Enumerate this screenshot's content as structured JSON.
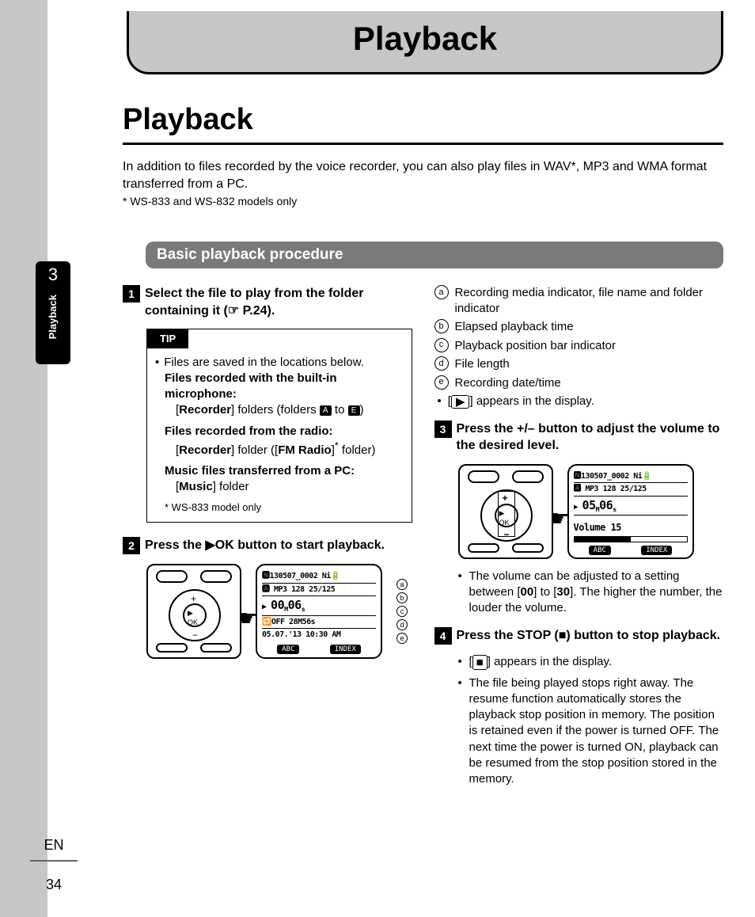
{
  "topTab": "Playback",
  "sectionTitle": "Playback",
  "intro": {
    "p1": "In addition to files recorded by the voice recorder, you can also play files in WAV*, MP3 and WMA format transferred from a PC.",
    "note": "* WS-833 and WS-832 models only"
  },
  "subhead": "Basic playback procedure",
  "sideTab": {
    "num": "3",
    "label": "Playback"
  },
  "footer": {
    "lang": "EN",
    "page": "34"
  },
  "steps": {
    "s1": {
      "num": "1",
      "textA": "Select the file to play from the folder containing it (",
      "pref": "☞ P.24",
      "textB": ")."
    },
    "tip": {
      "label": "TIP",
      "intro": "Files are saved in the locations below.",
      "h1": "Files recorded with the built-in microphone:",
      "d1a": "[",
      "d1b": "Recorder",
      "d1c": "] folders (folders ",
      "fA": "A",
      "d1d": " to ",
      "fE": "E",
      "d1e": ")",
      "h2": "Files recorded from the radio:",
      "d2a": "[",
      "d2b": "Recorder",
      "d2c": "] folder ([",
      "d2d": "FM Radio",
      "d2e": "]",
      "d2star": "*",
      "d2f": " folder)",
      "h3": "Music files transferred from a PC:",
      "d3a": "[",
      "d3b": "Music",
      "d3c": "] folder",
      "note": "* WS-833 model only"
    },
    "s2": {
      "num": "2",
      "textA": "Press the ",
      "btn": "▶OK",
      "textB": " button to start playback."
    },
    "screen1": {
      "l1": "🅽130507_0002 Ni🔋",
      "l2": "🅰 MP3 128      25/125",
      "l3a": "▶ ",
      "l3b": "00",
      "l3m": "M",
      "l3c": "06",
      "l3s": "s",
      "l4": "🔁OFF       28M56s",
      "l5": "05.07.'13 10:30 AM",
      "soft1": "ABC",
      "soft2": "INDEX"
    },
    "callouts": {
      "a": "a",
      "b": "b",
      "c": "c",
      "d": "d",
      "e": "e"
    },
    "legend": {
      "a": "Recording media indicator, file name and folder indicator",
      "b": "Elapsed playback time",
      "c": "Playback position bar indicator",
      "d": "File length",
      "e": "Recording date/time",
      "bullet": "] appears in the display.",
      "bulletPre": "["
    },
    "s3": {
      "num": "3",
      "text": "Press the +/– button to adjust the volume to the desired level."
    },
    "screen2": {
      "l1": "🅽130507_0002 Ni🔋",
      "l2": "🅰 MP3 128      25/125",
      "l3a": "▶ ",
      "l3b": "05",
      "l3m": "M",
      "l3c": "06",
      "l3s": "s",
      "vol": "Volume   15",
      "soft1": "ABC",
      "soft2": "INDEX"
    },
    "volNote": {
      "a": "The volume can be adjusted to a setting between [",
      "b": "00",
      "c": "] to [",
      "d": "30",
      "e": "]. The higher the number, the louder the volume."
    },
    "s4": {
      "num": "4",
      "textA": "Press the ",
      "stop": "STOP",
      "textB": " (",
      "sq": "■",
      "textC": ") button to stop playback."
    },
    "s4bullets": {
      "b1pre": "[",
      "b1post": "] appears in the display.",
      "b2": "The file being played stops right away. The resume function automatically stores the playback stop position in memory. The position is retained even if the power is turned OFF. The next time the power is turned ON, playback can be resumed from the stop position stored in the memory."
    }
  }
}
